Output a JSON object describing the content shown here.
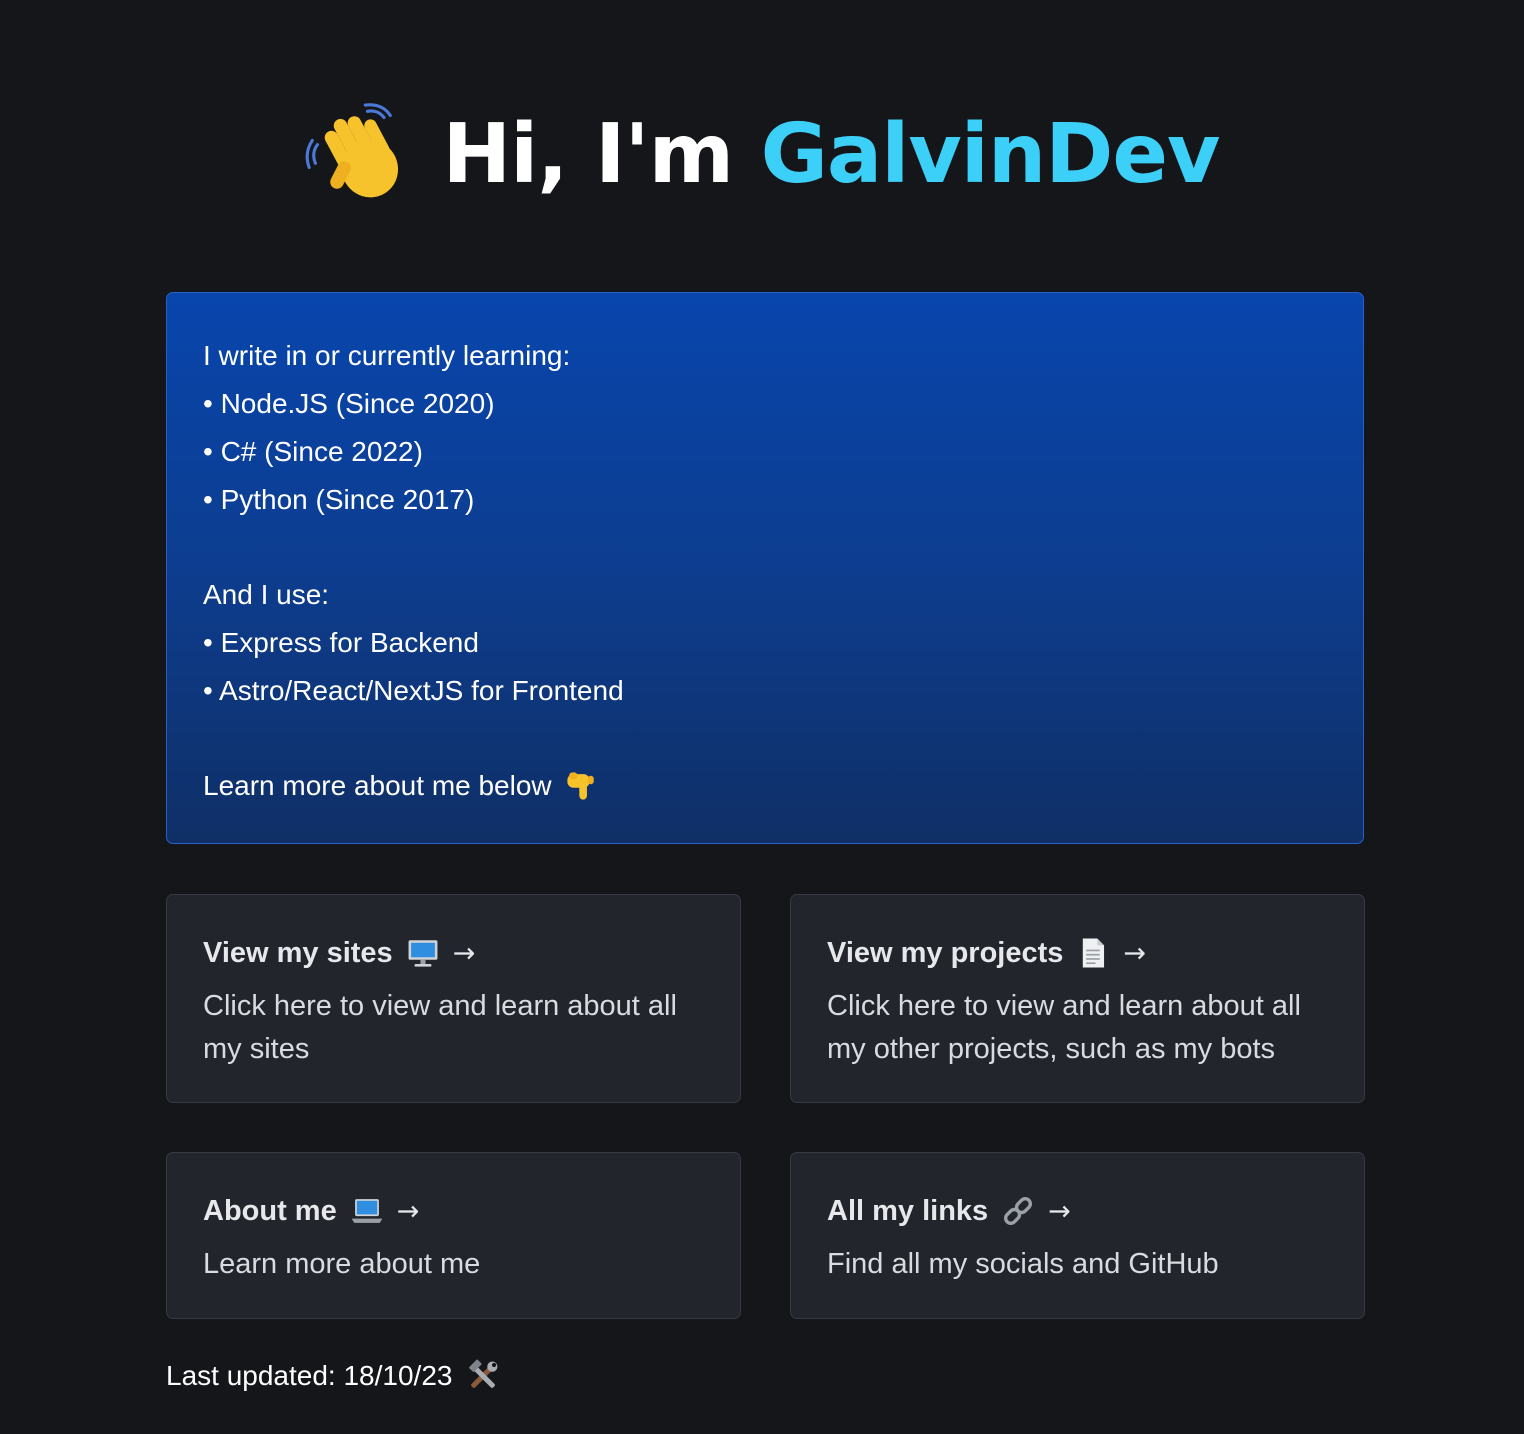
{
  "colors": {
    "background": "#15161a",
    "accent": "#3ccff7",
    "card_bg": "#22252b",
    "intro_gradient_top": "#0845ad",
    "intro_gradient_bottom": "#0f2f66"
  },
  "hero": {
    "wave_icon": "waving-hand-icon",
    "greeting": "Hi, I'm",
    "name": "GalvinDev"
  },
  "intro": {
    "heading": "I write in or currently learning:",
    "languages": [
      "• Node.JS (Since 2020)",
      "• C# (Since 2022)",
      "• Python (Since 2017)"
    ],
    "tools_heading": "And I use:",
    "tools": [
      "• Express for Backend",
      "• Astro/React/NextJS for Frontend"
    ],
    "learn_more": "Learn more about me below",
    "learn_more_icon": "pointing-down-hand-icon"
  },
  "cards": {
    "sites": {
      "title": "View my sites",
      "icon": "desktop-computer-icon",
      "arrow": "→",
      "description": "Click here to view and learn about all my sites"
    },
    "projects": {
      "title": "View my projects",
      "icon": "document-icon",
      "arrow": "→",
      "description": "Click here to view and learn about all my other projects, such as my bots"
    },
    "about": {
      "title": "About me",
      "icon": "laptop-icon",
      "arrow": "→",
      "description": "Learn more about me"
    },
    "links": {
      "title": "All my links",
      "icon": "link-icon",
      "arrow": "→",
      "description": "Find all my socials and GitHub"
    }
  },
  "footer": {
    "last_updated": "Last updated: 18/10/23",
    "icon": "hammer-and-wrench-icon"
  }
}
